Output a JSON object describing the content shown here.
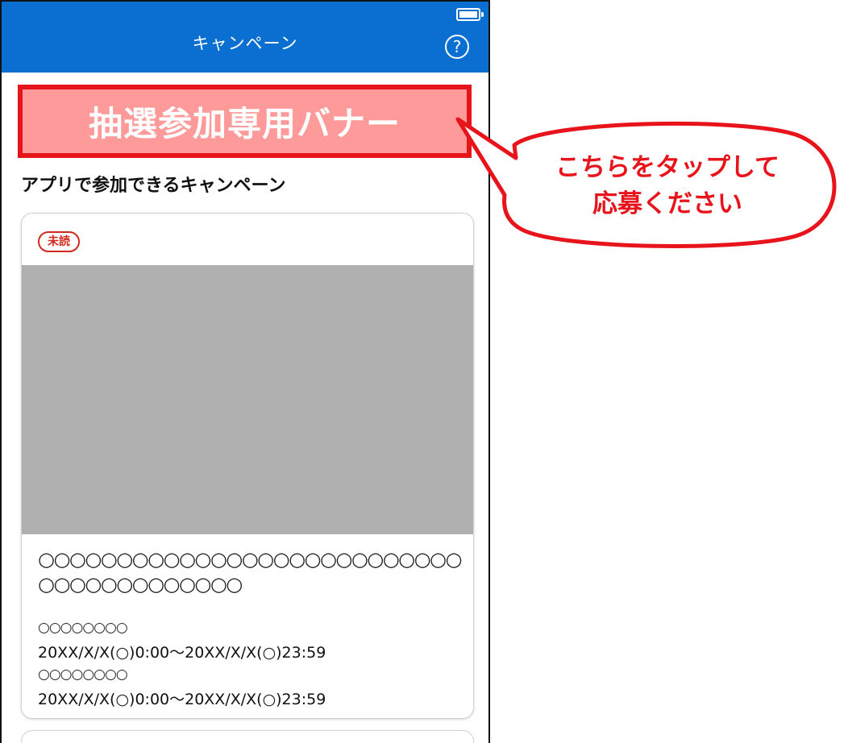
{
  "app": {
    "title": "キャンペーン",
    "help_icon_glyph": "?",
    "accent_color": "#0a6fd0"
  },
  "banner": {
    "label": "抽選参加専用バナー",
    "fill_color": "#ff9a9a",
    "border_color": "#e8141b"
  },
  "section": {
    "title": "アプリで参加できるキャンペーン"
  },
  "campaign_card": {
    "badge": "未読",
    "title": "○○○○○○○○○○○○○○○○○○○○○○○○○○○○○○○○○○○○○○○○",
    "periods": [
      {
        "label": "○○○○○○○○",
        "value": "20XX/X/X(○)0:00〜20XX/X/X(○)23:59"
      },
      {
        "label": "○○○○○○○○",
        "value": "20XX/X/X(○)0:00〜20XX/X/X(○)23:59"
      }
    ]
  },
  "callout": {
    "line1": "こちらをタップして",
    "line2": "応募ください",
    "color": "#e8141b"
  }
}
